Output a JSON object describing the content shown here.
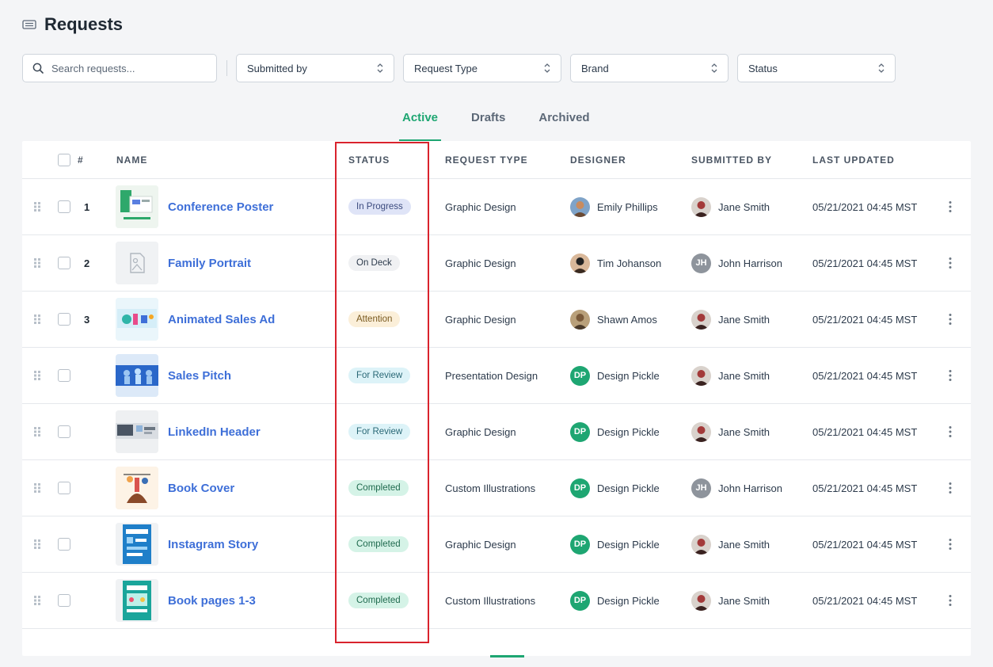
{
  "header": {
    "title": "Requests",
    "icon": "ticket-icon"
  },
  "filters": {
    "search_placeholder": "Search requests...",
    "submitted_by": "Submitted by",
    "request_type": "Request Type",
    "brand": "Brand",
    "status": "Status"
  },
  "tabs": [
    {
      "label": "Active",
      "active": true
    },
    {
      "label": "Drafts",
      "active": false
    },
    {
      "label": "Archived",
      "active": false
    }
  ],
  "columns": {
    "num": "#",
    "name": "NAME",
    "status": "STATUS",
    "request_type": "REQUEST TYPE",
    "designer": "DESIGNER",
    "submitted_by": "SUBMITTED BY",
    "last_updated": "LAST UPDATED"
  },
  "colors": {
    "accent": "#1ea672",
    "link": "#3e6fd8",
    "highlight": "#d9232d"
  },
  "rows": [
    {
      "num": "1",
      "name": "Conference Poster",
      "status": "In Progress",
      "request_type": "Graphic Design",
      "designer": "Emily Phillips",
      "submitted_by": "Jane Smith",
      "last_updated": "05/21/2021 04:45 MST"
    },
    {
      "num": "2",
      "name": "Family Portrait",
      "status": "On Deck",
      "request_type": "Graphic Design",
      "designer": "Tim Johanson",
      "submitted_by": "John Harrison",
      "last_updated": "05/21/2021 04:45 MST"
    },
    {
      "num": "3",
      "name": "Animated Sales Ad",
      "status": "Attention",
      "request_type": "Graphic Design",
      "designer": "Shawn Amos",
      "submitted_by": "Jane Smith",
      "last_updated": "05/21/2021 04:45 MST"
    },
    {
      "num": "",
      "name": "Sales Pitch",
      "status": "For Review",
      "request_type": "Presentation Design",
      "designer": "Design Pickle",
      "submitted_by": "Jane Smith",
      "last_updated": "05/21/2021 04:45 MST"
    },
    {
      "num": "",
      "name": "LinkedIn Header",
      "status": "For Review",
      "request_type": "Graphic Design",
      "designer": "Design Pickle",
      "submitted_by": "Jane Smith",
      "last_updated": "05/21/2021 04:45 MST"
    },
    {
      "num": "",
      "name": "Book Cover",
      "status": "Completed",
      "request_type": "Custom Illustrations",
      "designer": "Design Pickle",
      "submitted_by": "John Harrison",
      "last_updated": "05/21/2021 04:45 MST"
    },
    {
      "num": "",
      "name": "Instagram Story",
      "status": "Completed",
      "request_type": "Graphic Design",
      "designer": "Design Pickle",
      "submitted_by": "Jane Smith",
      "last_updated": "05/21/2021 04:45 MST"
    },
    {
      "num": "",
      "name": "Book pages 1-3",
      "status": "Completed",
      "request_type": "Custom Illustrations",
      "designer": "Design Pickle",
      "submitted_by": "Jane Smith",
      "last_updated": "05/21/2021 04:45 MST"
    }
  ],
  "initials": {
    "dp": "DP",
    "jh": "JH"
  }
}
